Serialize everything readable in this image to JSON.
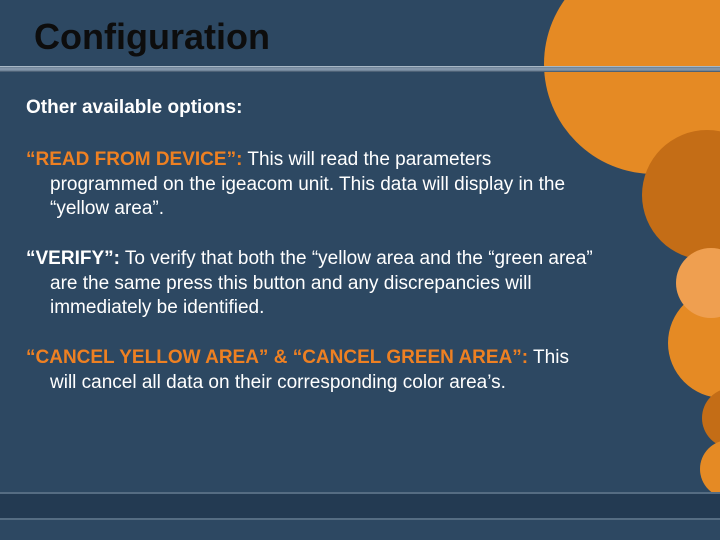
{
  "title": "Configuration",
  "subtitle": "Other available options:",
  "sections": [
    {
      "label": "“READ FROM DEVICE”:",
      "label_class": "orange",
      "text": "  This will read the parameters programmed on the igeacom unit.  This data will display in the “yellow area”."
    },
    {
      "label": "“VERIFY”:",
      "label_class": "white",
      "text": "  To verify that both the “yellow area and the “green area” are the same press this button and any discrepancies will immediately be identified."
    },
    {
      "label": "“CANCEL YELLOW AREA” & “CANCEL GREEN AREA”:",
      "label_class": "orange",
      "text": "  This will cancel all data on their corresponding color area’s."
    }
  ]
}
